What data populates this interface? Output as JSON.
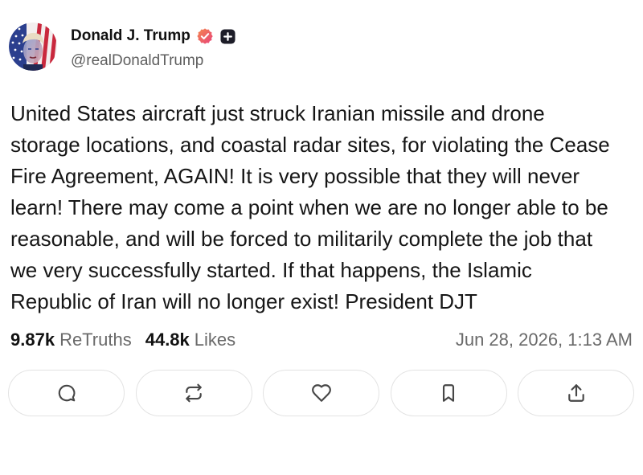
{
  "author": {
    "name": "Donald J. Trump",
    "handle": "@realDonaldTrump",
    "verified_icon": "verified-badge-icon",
    "plus_icon": "plus-badge-icon"
  },
  "post": {
    "lines": [
      "United States aircraft just struck Iranian missile and drone",
      "storage locations, and coastal radar sites, for violating the Cease",
      "Fire Agreement, AGAIN! It is very possible that they will never",
      "learn! There may come a point when we are no longer able to be",
      "reasonable, and will be forced to militarily complete the job that",
      "we very successfully started. If that happens, the Islamic",
      "Republic of Iran will no longer exist! President DJT"
    ]
  },
  "stats": {
    "retruths_count": "9.87k",
    "retruths_label": "ReTruths",
    "likes_count": "44.8k",
    "likes_label": "Likes",
    "timestamp": "Jun 28, 2026, 1:13 AM"
  },
  "actions": [
    "comment-icon",
    "repost-icon",
    "heart-icon",
    "bookmark-icon",
    "share-icon"
  ],
  "colors": {
    "background": "#ffffff",
    "text": "#141414",
    "muted": "#6a6a6a",
    "border": "#e3e3e3",
    "verified": "#ee5a70",
    "badge_dark": "#1d1d28",
    "icon": "#474747"
  }
}
